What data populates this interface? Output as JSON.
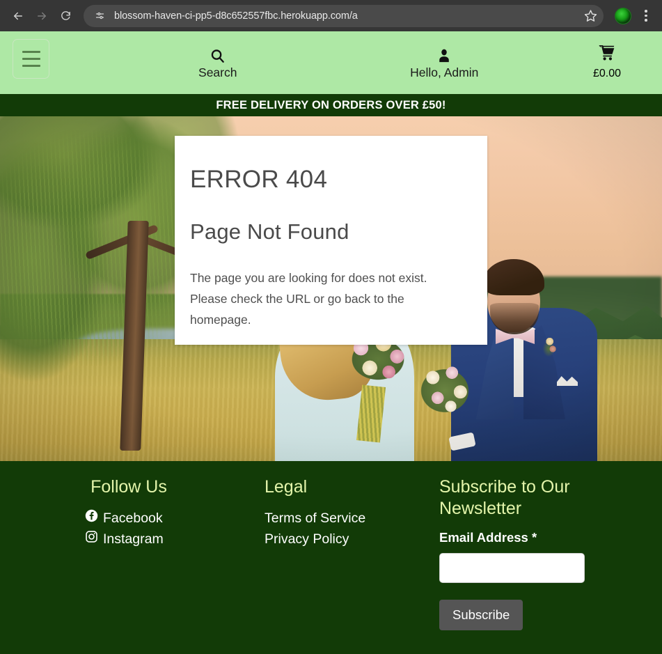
{
  "browser": {
    "url": "blossom-haven-ci-pp5-d8c652557fbc.herokuapp.com/a",
    "back_label": "Back",
    "forward_label": "Forward",
    "reload_label": "Reload",
    "site_info_label": "View site information",
    "bookmark_label": "Bookmark this tab",
    "profile_label": "Profile",
    "menu_label": "Customize and control Chrome"
  },
  "header": {
    "menu_label": "Menu",
    "search_label": "Search",
    "account_label": "Hello, Admin",
    "cart_total": "£0.00",
    "bg_color": "#aee8a5"
  },
  "banner": {
    "text": "FREE DELIVERY ON ORDERS OVER £50!",
    "bg_color": "#123b07"
  },
  "error_card": {
    "title": "ERROR 404",
    "subtitle": "Page Not Found",
    "message": "The page you are looking for does not exist. Please check the URL or go back to the homepage."
  },
  "footer": {
    "bg_color": "#123b07",
    "heading_color": "#e4f5ab",
    "social": {
      "heading": "Follow Us",
      "links": [
        {
          "label": "Facebook",
          "icon": "facebook-icon"
        },
        {
          "label": "Instagram",
          "icon": "instagram-icon"
        }
      ]
    },
    "legal": {
      "heading": "Legal",
      "links": [
        {
          "label": "Terms of Service"
        },
        {
          "label": "Privacy Policy"
        }
      ]
    },
    "newsletter": {
      "heading": "Subscribe to Our Newsletter",
      "email_label": "Email Address *",
      "email_value": "",
      "email_placeholder": "",
      "submit_label": "Subscribe",
      "submit_color": "#555555"
    }
  }
}
